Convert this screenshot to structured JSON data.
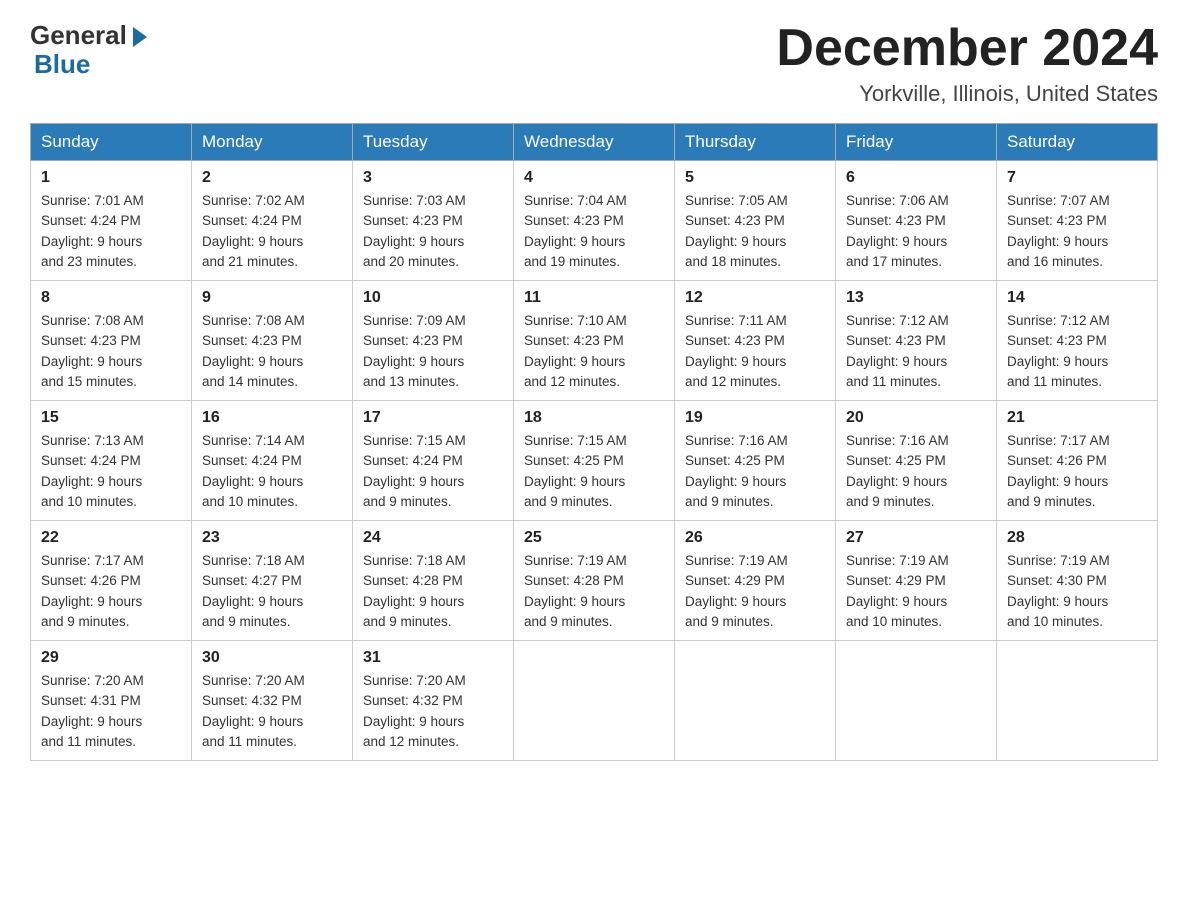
{
  "logo": {
    "general": "General",
    "blue": "Blue"
  },
  "title": "December 2024",
  "location": "Yorkville, Illinois, United States",
  "weekdays": [
    "Sunday",
    "Monday",
    "Tuesday",
    "Wednesday",
    "Thursday",
    "Friday",
    "Saturday"
  ],
  "weeks": [
    [
      {
        "day": "1",
        "sunrise": "7:01 AM",
        "sunset": "4:24 PM",
        "daylight": "9 hours and 23 minutes."
      },
      {
        "day": "2",
        "sunrise": "7:02 AM",
        "sunset": "4:24 PM",
        "daylight": "9 hours and 21 minutes."
      },
      {
        "day": "3",
        "sunrise": "7:03 AM",
        "sunset": "4:23 PM",
        "daylight": "9 hours and 20 minutes."
      },
      {
        "day": "4",
        "sunrise": "7:04 AM",
        "sunset": "4:23 PM",
        "daylight": "9 hours and 19 minutes."
      },
      {
        "day": "5",
        "sunrise": "7:05 AM",
        "sunset": "4:23 PM",
        "daylight": "9 hours and 18 minutes."
      },
      {
        "day": "6",
        "sunrise": "7:06 AM",
        "sunset": "4:23 PM",
        "daylight": "9 hours and 17 minutes."
      },
      {
        "day": "7",
        "sunrise": "7:07 AM",
        "sunset": "4:23 PM",
        "daylight": "9 hours and 16 minutes."
      }
    ],
    [
      {
        "day": "8",
        "sunrise": "7:08 AM",
        "sunset": "4:23 PM",
        "daylight": "9 hours and 15 minutes."
      },
      {
        "day": "9",
        "sunrise": "7:08 AM",
        "sunset": "4:23 PM",
        "daylight": "9 hours and 14 minutes."
      },
      {
        "day": "10",
        "sunrise": "7:09 AM",
        "sunset": "4:23 PM",
        "daylight": "9 hours and 13 minutes."
      },
      {
        "day": "11",
        "sunrise": "7:10 AM",
        "sunset": "4:23 PM",
        "daylight": "9 hours and 12 minutes."
      },
      {
        "day": "12",
        "sunrise": "7:11 AM",
        "sunset": "4:23 PM",
        "daylight": "9 hours and 12 minutes."
      },
      {
        "day": "13",
        "sunrise": "7:12 AM",
        "sunset": "4:23 PM",
        "daylight": "9 hours and 11 minutes."
      },
      {
        "day": "14",
        "sunrise": "7:12 AM",
        "sunset": "4:23 PM",
        "daylight": "9 hours and 11 minutes."
      }
    ],
    [
      {
        "day": "15",
        "sunrise": "7:13 AM",
        "sunset": "4:24 PM",
        "daylight": "9 hours and 10 minutes."
      },
      {
        "day": "16",
        "sunrise": "7:14 AM",
        "sunset": "4:24 PM",
        "daylight": "9 hours and 10 minutes."
      },
      {
        "day": "17",
        "sunrise": "7:15 AM",
        "sunset": "4:24 PM",
        "daylight": "9 hours and 9 minutes."
      },
      {
        "day": "18",
        "sunrise": "7:15 AM",
        "sunset": "4:25 PM",
        "daylight": "9 hours and 9 minutes."
      },
      {
        "day": "19",
        "sunrise": "7:16 AM",
        "sunset": "4:25 PM",
        "daylight": "9 hours and 9 minutes."
      },
      {
        "day": "20",
        "sunrise": "7:16 AM",
        "sunset": "4:25 PM",
        "daylight": "9 hours and 9 minutes."
      },
      {
        "day": "21",
        "sunrise": "7:17 AM",
        "sunset": "4:26 PM",
        "daylight": "9 hours and 9 minutes."
      }
    ],
    [
      {
        "day": "22",
        "sunrise": "7:17 AM",
        "sunset": "4:26 PM",
        "daylight": "9 hours and 9 minutes."
      },
      {
        "day": "23",
        "sunrise": "7:18 AM",
        "sunset": "4:27 PM",
        "daylight": "9 hours and 9 minutes."
      },
      {
        "day": "24",
        "sunrise": "7:18 AM",
        "sunset": "4:28 PM",
        "daylight": "9 hours and 9 minutes."
      },
      {
        "day": "25",
        "sunrise": "7:19 AM",
        "sunset": "4:28 PM",
        "daylight": "9 hours and 9 minutes."
      },
      {
        "day": "26",
        "sunrise": "7:19 AM",
        "sunset": "4:29 PM",
        "daylight": "9 hours and 9 minutes."
      },
      {
        "day": "27",
        "sunrise": "7:19 AM",
        "sunset": "4:29 PM",
        "daylight": "9 hours and 10 minutes."
      },
      {
        "day": "28",
        "sunrise": "7:19 AM",
        "sunset": "4:30 PM",
        "daylight": "9 hours and 10 minutes."
      }
    ],
    [
      {
        "day": "29",
        "sunrise": "7:20 AM",
        "sunset": "4:31 PM",
        "daylight": "9 hours and 11 minutes."
      },
      {
        "day": "30",
        "sunrise": "7:20 AM",
        "sunset": "4:32 PM",
        "daylight": "9 hours and 11 minutes."
      },
      {
        "day": "31",
        "sunrise": "7:20 AM",
        "sunset": "4:32 PM",
        "daylight": "9 hours and 12 minutes."
      },
      null,
      null,
      null,
      null
    ]
  ],
  "labels": {
    "sunrise": "Sunrise:",
    "sunset": "Sunset:",
    "daylight": "Daylight:"
  }
}
